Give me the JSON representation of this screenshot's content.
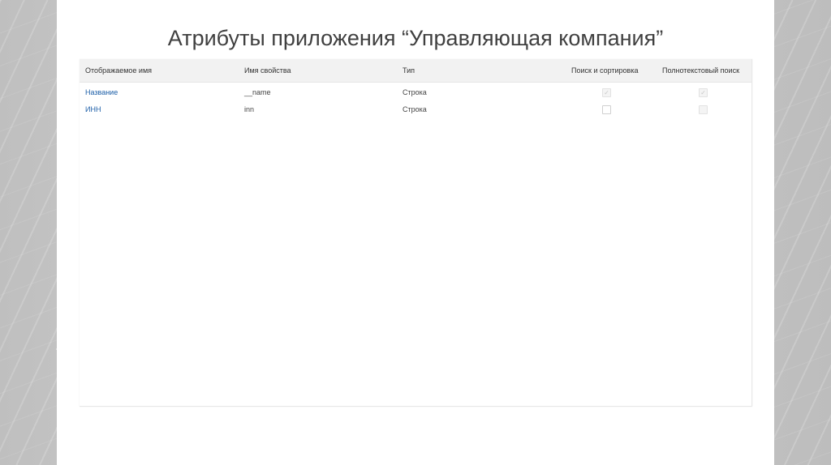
{
  "slide": {
    "title": "Атрибуты приложения “Управляющая компания”"
  },
  "table": {
    "columns": [
      "Отображаемое имя",
      "Имя свойства",
      "Тип",
      "Поиск и сортировка",
      "Полнотекстовый поиск"
    ],
    "rows": [
      {
        "display_name": "Название",
        "property_name": "__name",
        "type": "Строка",
        "search_sort": true,
        "fulltext": true,
        "search_sort_disabled": true,
        "fulltext_disabled": true
      },
      {
        "display_name": "ИНН",
        "property_name": "inn",
        "type": "Строка",
        "search_sort": false,
        "fulltext": false,
        "search_sort_disabled": false,
        "fulltext_disabled": true
      }
    ]
  },
  "colors": {
    "link": "#1d5fa8",
    "header_bg": "#f2f2f2",
    "background": "#c4c4c4"
  },
  "icons": {
    "checked": "check-icon"
  }
}
